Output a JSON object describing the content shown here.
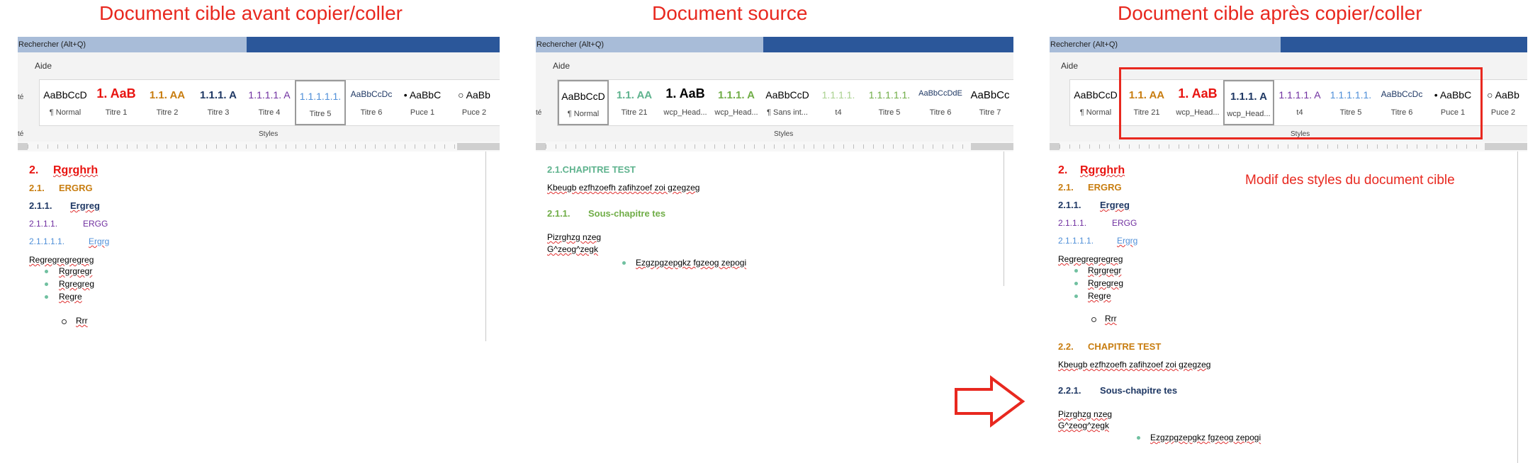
{
  "titles": {
    "before": "Document cible avant copier/coller",
    "source": "Document source",
    "after": "Document cible après copier/coller"
  },
  "common": {
    "search": "Rechercher (Alt+Q)",
    "aide": "Aide",
    "styles_group": "Styles",
    "side_a": "té",
    "side_b": "té"
  },
  "panel1": {
    "styles": [
      {
        "preview": "AaBbCcD",
        "name": "¶ Normal"
      },
      {
        "preview": "1. AaB",
        "name": "Titre 1"
      },
      {
        "preview": "1.1. AA",
        "name": "Titre 2"
      },
      {
        "preview": "1.1.1. A",
        "name": "Titre 3"
      },
      {
        "preview": "1.1.1.1. A",
        "name": "Titre 4"
      },
      {
        "preview": "1.1.1.1.1.",
        "name": "Titre 5"
      },
      {
        "preview": "AaBbCcDc",
        "name": "Titre 6"
      },
      {
        "preview": "• AaBbC",
        "name": "Puce 1"
      },
      {
        "preview": "○ AaBb",
        "name": "Puce 2"
      }
    ],
    "doc": {
      "h1_num": "2.",
      "h1_text": "Rgrghrh",
      "h2_num": "2.1.",
      "h2_text": "ERGRG",
      "h3_num": "2.1.1.",
      "h3_text": "Ergreg",
      "h4_num": "2.1.1.1.",
      "h4_text": "ERGG",
      "h5_num": "2.1.1.1.1.",
      "h5_text": "Ergrg",
      "para": "Regregregregreg",
      "bullets": [
        "Rgrgregr",
        "Rgregreg",
        "Regre"
      ],
      "sub_bullet": "Rrr"
    }
  },
  "panel2": {
    "styles": [
      {
        "preview": "AaBbCcD",
        "name": "¶ Normal"
      },
      {
        "preview": "1.1. AA",
        "name": "Titre 21"
      },
      {
        "preview": "1. AaB",
        "name": "wcp_Head..."
      },
      {
        "preview": "1.1.1. A",
        "name": "wcp_Head..."
      },
      {
        "preview": "AaBbCcD",
        "name": "¶ Sans int..."
      },
      {
        "preview": "1.1.1.1.",
        "name": "t4"
      },
      {
        "preview": "1.1.1.1.1.",
        "name": "Titre 5"
      },
      {
        "preview": "AaBbCcDdE",
        "name": "Titre 6"
      },
      {
        "preview": "AaBbCc",
        "name": "Titre 7"
      }
    ],
    "doc": {
      "h_top": "2.1.CHAPITRE TEST",
      "p1": "Kbeugb ezfhzoefh zafihzoef zoi gzegzeg",
      "h_sub_num": "2.1.1.",
      "h_sub_text": "Sous-chapitre tes",
      "p2": "Pizrghzg nzeg",
      "p3": "G^zeog^zegk",
      "bullet": "Ezgzpgzepgkz fgzeog zepogi"
    }
  },
  "panel3": {
    "styles": [
      {
        "preview": "AaBbCcD",
        "name": "¶ Normal"
      },
      {
        "preview": "1.1. AA",
        "name": "Titre 21"
      },
      {
        "preview": "1. AaB",
        "name": "wcp_Head..."
      },
      {
        "preview": "1.1.1. A",
        "name": "wcp_Head..."
      },
      {
        "preview": "1.1.1.1. A",
        "name": "t4"
      },
      {
        "preview": "1.1.1.1.1.",
        "name": "Titre 5"
      },
      {
        "preview": "AaBbCcDc",
        "name": "Titre 6"
      },
      {
        "preview": "• AaBbC",
        "name": "Puce 1"
      },
      {
        "preview": "○ AaBb",
        "name": "Puce 2"
      }
    ],
    "annotation": "Modif des styles du document cible",
    "doc": {
      "h1_num": "2.",
      "h1_text": "Rgrghrh",
      "h2_num": "2.1.",
      "h2_text": "ERGRG",
      "h3_num": "2.1.1.",
      "h3_text": "Ergreg",
      "h4_num": "2.1.1.1.",
      "h4_text": "ERGG",
      "h5_num": "2.1.1.1.1.",
      "h5_text": "Ergrg",
      "para": "Regregregregreg",
      "bullets": [
        "Rgrgregr",
        "Rgregreg",
        "Regre"
      ],
      "sub_bullet": "Rrr",
      "h2b_num": "2.2.",
      "h2b_text": "CHAPITRE TEST",
      "p1": "Kbeugb ezfhzoefh zafihzoef zoi gzegzeg",
      "h3b_num": "2.2.1.",
      "h3b_text": "Sous-chapitre tes",
      "p2": "Pizrghzg nzeg",
      "p3": "G^zeog^zegk",
      "bullet": "Ezgzpgzepgkz fgzeog zepogi"
    }
  },
  "colors": {
    "accent_red": "#e8281f",
    "titlebar": "#2b579a"
  }
}
